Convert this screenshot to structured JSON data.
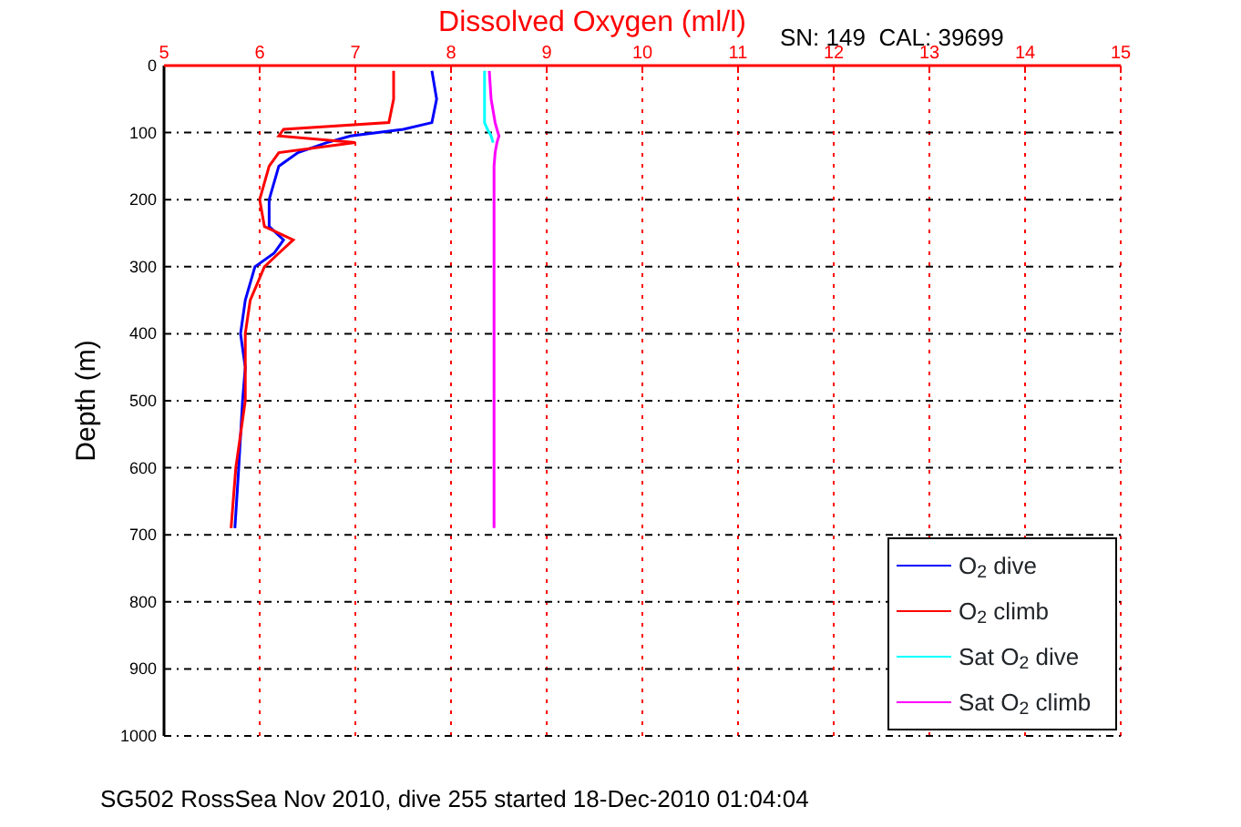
{
  "chart_data": {
    "type": "line",
    "orientation": "horizontal",
    "title": "Dissolved Oxygen (ml/l)",
    "ylabel": "Depth (m)",
    "xlim": [
      5,
      15
    ],
    "ylim": [
      1000,
      0
    ],
    "xticks": [
      5,
      6,
      7,
      8,
      9,
      10,
      11,
      12,
      13,
      14,
      15
    ],
    "yticks": [
      0,
      100,
      200,
      300,
      400,
      500,
      600,
      700,
      800,
      900,
      1000
    ],
    "grid": true,
    "x": [
      8,
      50,
      85,
      95,
      105,
      115,
      130,
      150,
      200,
      240,
      260,
      280,
      300,
      350,
      400,
      450,
      500,
      600,
      690
    ],
    "series": [
      {
        "name": "O$_{2}$ dive",
        "color": "#0000ff",
        "values": [
          7.8,
          7.85,
          7.8,
          7.5,
          6.95,
          6.7,
          6.4,
          6.2,
          6.1,
          6.1,
          6.25,
          6.15,
          5.95,
          5.85,
          5.8,
          5.85,
          5.82,
          5.78,
          5.74
        ]
      },
      {
        "name": "O$_{2}$ climb",
        "color": "#ff0000",
        "values": [
          7.4,
          7.4,
          7.35,
          6.25,
          6.2,
          7.0,
          6.2,
          6.1,
          6.0,
          6.05,
          6.35,
          6.2,
          6.05,
          5.9,
          5.85,
          5.85,
          5.85,
          5.75,
          5.7
        ]
      },
      {
        "name": "Sat O$_{2}$ dive",
        "color": "#00ffff",
        "values": [
          8.35,
          8.35,
          8.35,
          8.38,
          8.42,
          8.44,
          null,
          null,
          null,
          null,
          null,
          null,
          null,
          null,
          null,
          null,
          null,
          null,
          null
        ]
      },
      {
        "name": "Sat O$_{2}$ climb",
        "color": "#ff00ff",
        "values": [
          8.4,
          8.42,
          8.46,
          8.48,
          8.5,
          8.48,
          8.46,
          8.45,
          8.45,
          8.45,
          8.45,
          8.45,
          8.45,
          8.45,
          8.45,
          8.45,
          8.45,
          8.45,
          8.45
        ]
      }
    ]
  },
  "serial": "SN: 149  CAL: 39699",
  "caption": "SG502 RossSea Nov 2010, dive 255 started 18-Dec-2010 01:04:04"
}
